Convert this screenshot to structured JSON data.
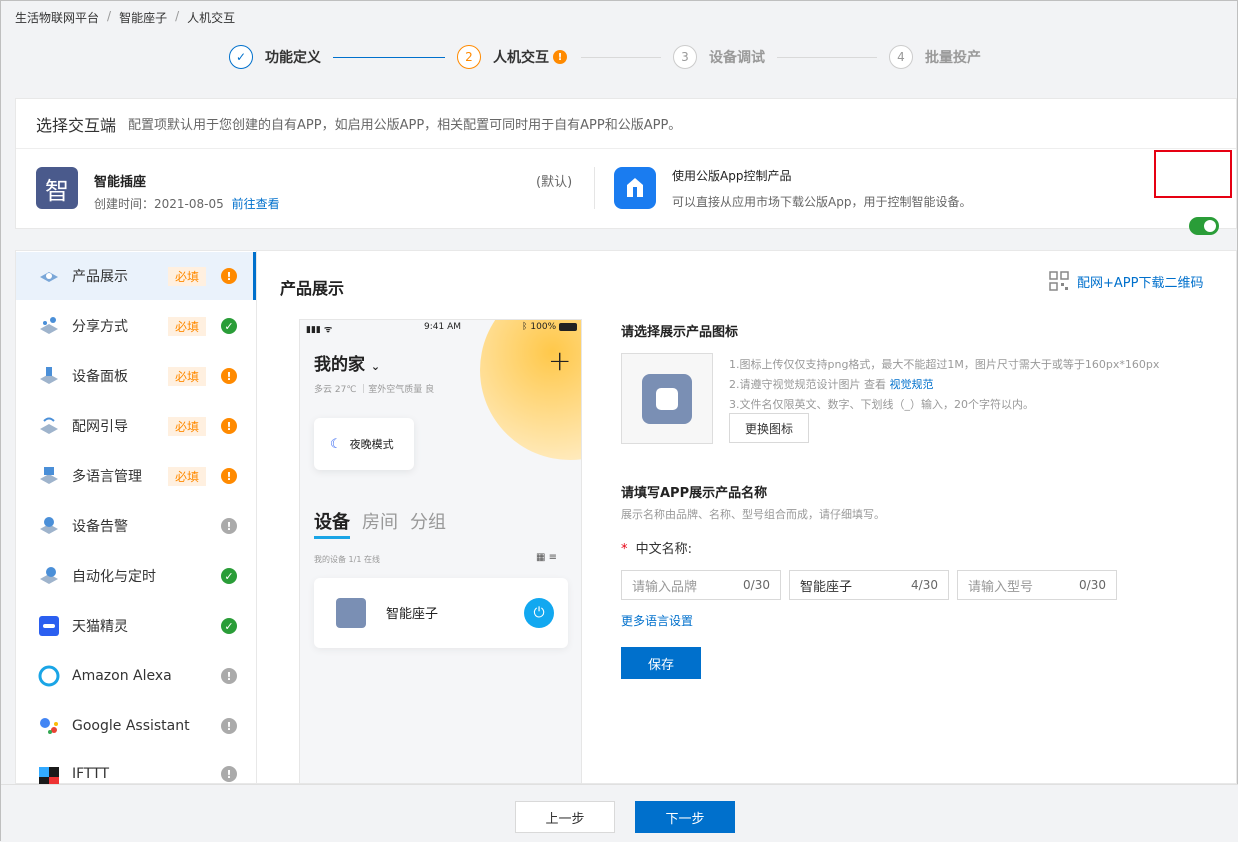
{
  "breadcrumb": {
    "items": [
      "生活物联网平台",
      "智能座子",
      "人机交互"
    ],
    "sep": "/"
  },
  "steps": [
    {
      "num": "✓",
      "label": "功能定义"
    },
    {
      "num": "2",
      "label": "人机交互",
      "warn": "!"
    },
    {
      "num": "3",
      "label": "设备调试"
    },
    {
      "num": "4",
      "label": "批量投产"
    }
  ],
  "select_card": {
    "title": "选择交互端",
    "desc": "配置项默认用于您创建的自有APP，如启用公版APP，相关配置可同时用于自有APP和公版APP。",
    "app": {
      "icon_char": "智",
      "name": "智能插座",
      "default_label": "(默认)",
      "created": "创建时间：2021-08-05",
      "link": "前往查看"
    },
    "public": {
      "title": "使用公版App控制产品",
      "desc": "可以直接从应用市场下载公版App，用于控制智能设备。",
      "enabled": true
    }
  },
  "nav": [
    {
      "label": "产品展示",
      "required": "必填",
      "status": "!"
    },
    {
      "label": "分享方式",
      "required": "必填",
      "status": "✓"
    },
    {
      "label": "设备面板",
      "required": "必填",
      "status": "!"
    },
    {
      "label": "配网引导",
      "required": "必填",
      "status": "!"
    },
    {
      "label": "多语言管理",
      "required": "必填",
      "status": "!"
    },
    {
      "label": "设备告警",
      "status": "!"
    },
    {
      "label": "自动化与定时",
      "status": "✓"
    },
    {
      "label": "天猫精灵",
      "status": "✓"
    },
    {
      "label": "Amazon Alexa",
      "status": "!"
    },
    {
      "label": "Google Assistant",
      "status": "!"
    },
    {
      "label": "IFTTT",
      "status": "!"
    }
  ],
  "main": {
    "title": "产品展示",
    "qr_link": "配网+APP下载二维码",
    "icon_section": {
      "title": "请选择展示产品图标",
      "rule1": "1.图标上传仅仅支持png格式，最大不能超过1M，图片尺寸需大于或等于160px*160px",
      "rule2": "2.请遵守视觉规范设计图片 查看",
      "rule2_link": "视觉规范",
      "rule3": "3.文件名仅限英文、数字、下划线（_）输入，20个字符以内。",
      "change_btn": "更换图标"
    },
    "name_section": {
      "title": "请填写APP展示产品名称",
      "hint": "展示名称由品牌、名称、型号组合而成，请仔细填写。",
      "required_mark": "*",
      "field_label": "中文名称:",
      "brand_placeholder": "请输入品牌",
      "brand_count": "0/30",
      "name_value": "智能座子",
      "name_count": "4/30",
      "model_placeholder": "请输入型号",
      "model_count": "0/30",
      "more_lang": "更多语言设置",
      "save_btn": "保存"
    }
  },
  "phone": {
    "time": "9:41 AM",
    "battery": "100%",
    "home": "我的家",
    "weather": "多云 27℃ ｜室外空气质量 良",
    "night_mode": "夜晚模式",
    "tabs": [
      "设备",
      "房间",
      "分组"
    ],
    "device_count": "我的设备  1/1 在线",
    "device_name": "智能座子"
  },
  "footer": {
    "prev": "上一步",
    "next": "下一步"
  },
  "colors": {
    "primary": "#0070cc",
    "warning": "#ff8a00",
    "success": "#2a9d38"
  }
}
